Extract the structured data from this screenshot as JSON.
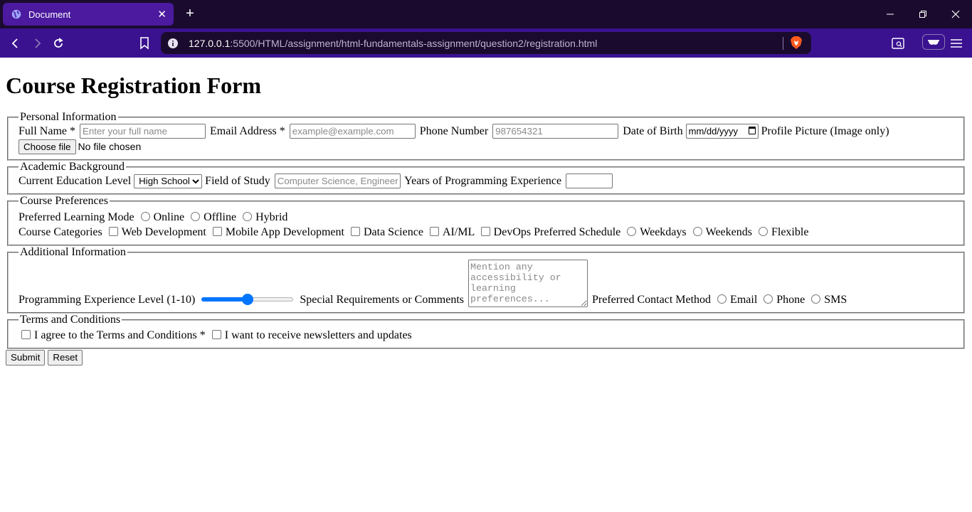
{
  "browser": {
    "tab_title": "Document",
    "url_host": "127.0.0.1",
    "url_rest": ":5500/HTML/assignment/html-fundamentals-assignment/question2/registration.html"
  },
  "page": {
    "title": "Course Registration Form"
  },
  "personal": {
    "legend": "Personal Information",
    "full_name_label": "Full Name *",
    "full_name_placeholder": "Enter your full name",
    "email_label": "Email Address *",
    "email_placeholder": "example@example.com",
    "phone_label": "Phone Number",
    "phone_placeholder": "987654321",
    "dob_label": "Date of Birth",
    "dob_placeholder": "mm/dd/yyyy",
    "picture_label": "Profile Picture (Image only)",
    "choose_file": "Choose file",
    "no_file": "No file chosen"
  },
  "academic": {
    "legend": "Academic Background",
    "education_label": "Current Education Level",
    "education_selected": "High School",
    "field_label": "Field of Study",
    "field_placeholder": "Computer Science, Engineering",
    "years_label": "Years of Programming Experience",
    "years_value": ""
  },
  "preferences": {
    "legend": "Course Preferences",
    "mode_label": "Preferred Learning Mode",
    "modes": [
      "Online",
      "Offline",
      "Hybrid"
    ],
    "categories_label": "Course Categories",
    "categories": [
      "Web Development",
      "Mobile App Development",
      "Data Science",
      "AI/ML",
      "DevOps"
    ],
    "schedule_label": "Preferred Schedule",
    "schedules": [
      "Weekdays",
      "Weekends",
      "Flexible"
    ]
  },
  "additional": {
    "legend": "Additional Information",
    "level_label": "Programming Experience Level (1-10)",
    "level_value": 5.5,
    "level_min": 1,
    "level_max": 10,
    "comments_label": "Special Requirements or Comments",
    "comments_placeholder": "Mention any accessibility or learning preferences...",
    "contact_label": "Preferred Contact Method",
    "contacts": [
      "Email",
      "Phone",
      "SMS"
    ]
  },
  "terms": {
    "legend": "Terms and Conditions",
    "agree_label": "I agree to the Terms and Conditions *",
    "newsletter_label": "I want to receive newsletters and updates"
  },
  "actions": {
    "submit": "Submit",
    "reset": "Reset"
  },
  "colors": {
    "tabbar": "#1a0b2e",
    "toolbar": "#3a1290",
    "active_tab": "#4b1a9e",
    "accent": "#0075ff"
  }
}
